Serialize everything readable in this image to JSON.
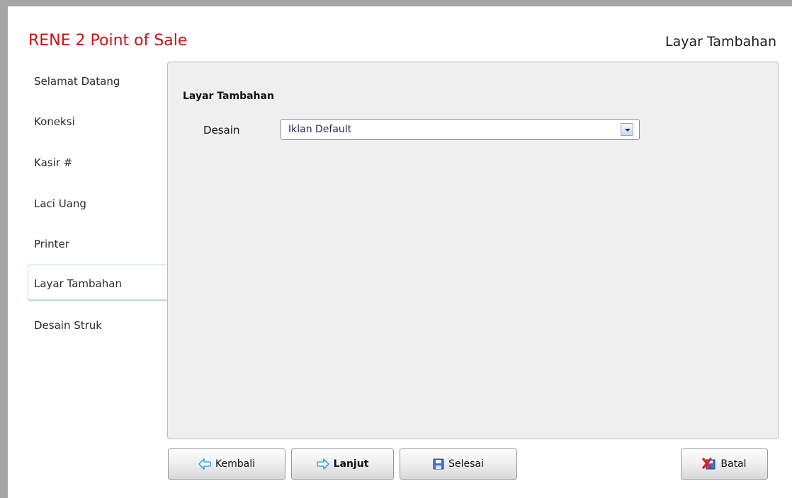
{
  "app": {
    "title": "RENE 2 Point of Sale",
    "page_heading": "Layar Tambahan"
  },
  "sidebar": {
    "items": [
      {
        "label": "Selamat Datang",
        "active": false
      },
      {
        "label": "Koneksi",
        "active": false
      },
      {
        "label": "Kasir #",
        "active": false
      },
      {
        "label": "Laci Uang",
        "active": false
      },
      {
        "label": "Printer",
        "active": false
      },
      {
        "label": "Layar Tambahan",
        "active": true
      },
      {
        "label": "Desain Struk",
        "active": false
      }
    ]
  },
  "panel": {
    "heading": "Layar Tambahan",
    "fields": [
      {
        "label": "Desain",
        "value": "Iklan Default"
      }
    ]
  },
  "buttons": {
    "back": {
      "label": "Kembali",
      "icon": "arrow-left-icon"
    },
    "next": {
      "label": "Lanjut",
      "icon": "arrow-right-icon"
    },
    "finish": {
      "label": "Selesai",
      "icon": "save-icon"
    },
    "cancel": {
      "label": "Batal",
      "icon": "cancel-icon"
    }
  },
  "colors": {
    "title": "#cc1212",
    "arrow_icon": "#3aa6e6",
    "save_icon": "#3b6fd1",
    "cancel_icon": "#d62626"
  }
}
